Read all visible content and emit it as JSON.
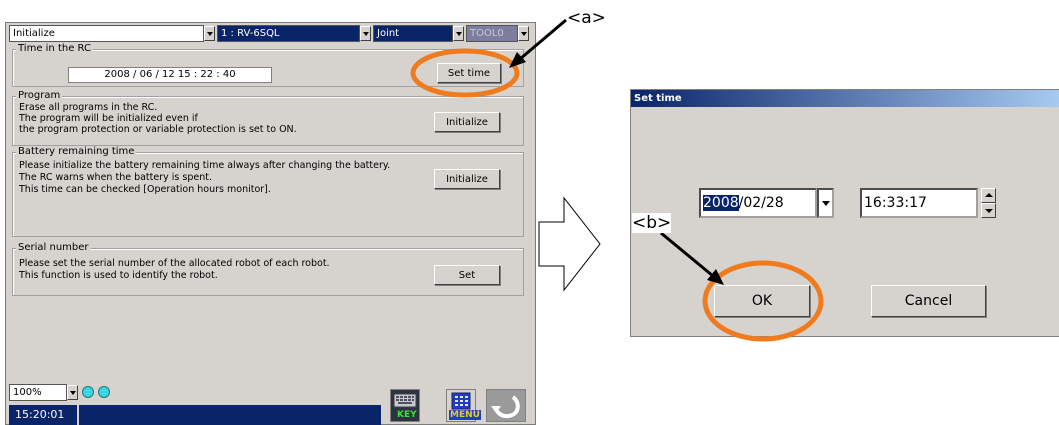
{
  "left_panel": {
    "mode_select": "Initialize",
    "robot_select": "1 : RV-6SQL",
    "coord_select": "Joint",
    "tool_select": "TOOL0",
    "time_group": {
      "label": "Time in the RC",
      "value": "2008 / 06 / 12   15 : 22 : 40",
      "button": "Set time"
    },
    "program_group": {
      "label": "Program",
      "lines": [
        "Erase all programs in the RC.",
        "The program will be initialized even if",
        "the program protection or variable protection is set to ON."
      ],
      "button": "Initialize"
    },
    "battery_group": {
      "label": "Battery remaining time",
      "lines": [
        "Please initialize the battery remaining time always after changing the battery.",
        "The RC warns when the battery is spent.",
        "This time can be checked [Operation hours monitor]."
      ],
      "button": "Initialize"
    },
    "serial_group": {
      "label": "Serial number",
      "lines": [
        "Please set the serial number of the allocated robot of each robot.",
        "This function is used to identify the robot."
      ],
      "button": "Set"
    },
    "zoom": "100%",
    "clock": "15:20:01",
    "key_label": "KEY",
    "menu_label": "MENU"
  },
  "dialog": {
    "title": "Set time",
    "date_year": "2008",
    "date_rest": "/02/28",
    "time": "16:33:17",
    "ok": "OK",
    "cancel": "Cancel"
  },
  "annotations": {
    "a": "<a>",
    "b": "<b>"
  },
  "colors": {
    "highlight_ellipse": "#f07a1e",
    "title_bar": "#0a246a",
    "panel_bg": "#d6d3ce",
    "status_dot": "#3fd4e0"
  }
}
